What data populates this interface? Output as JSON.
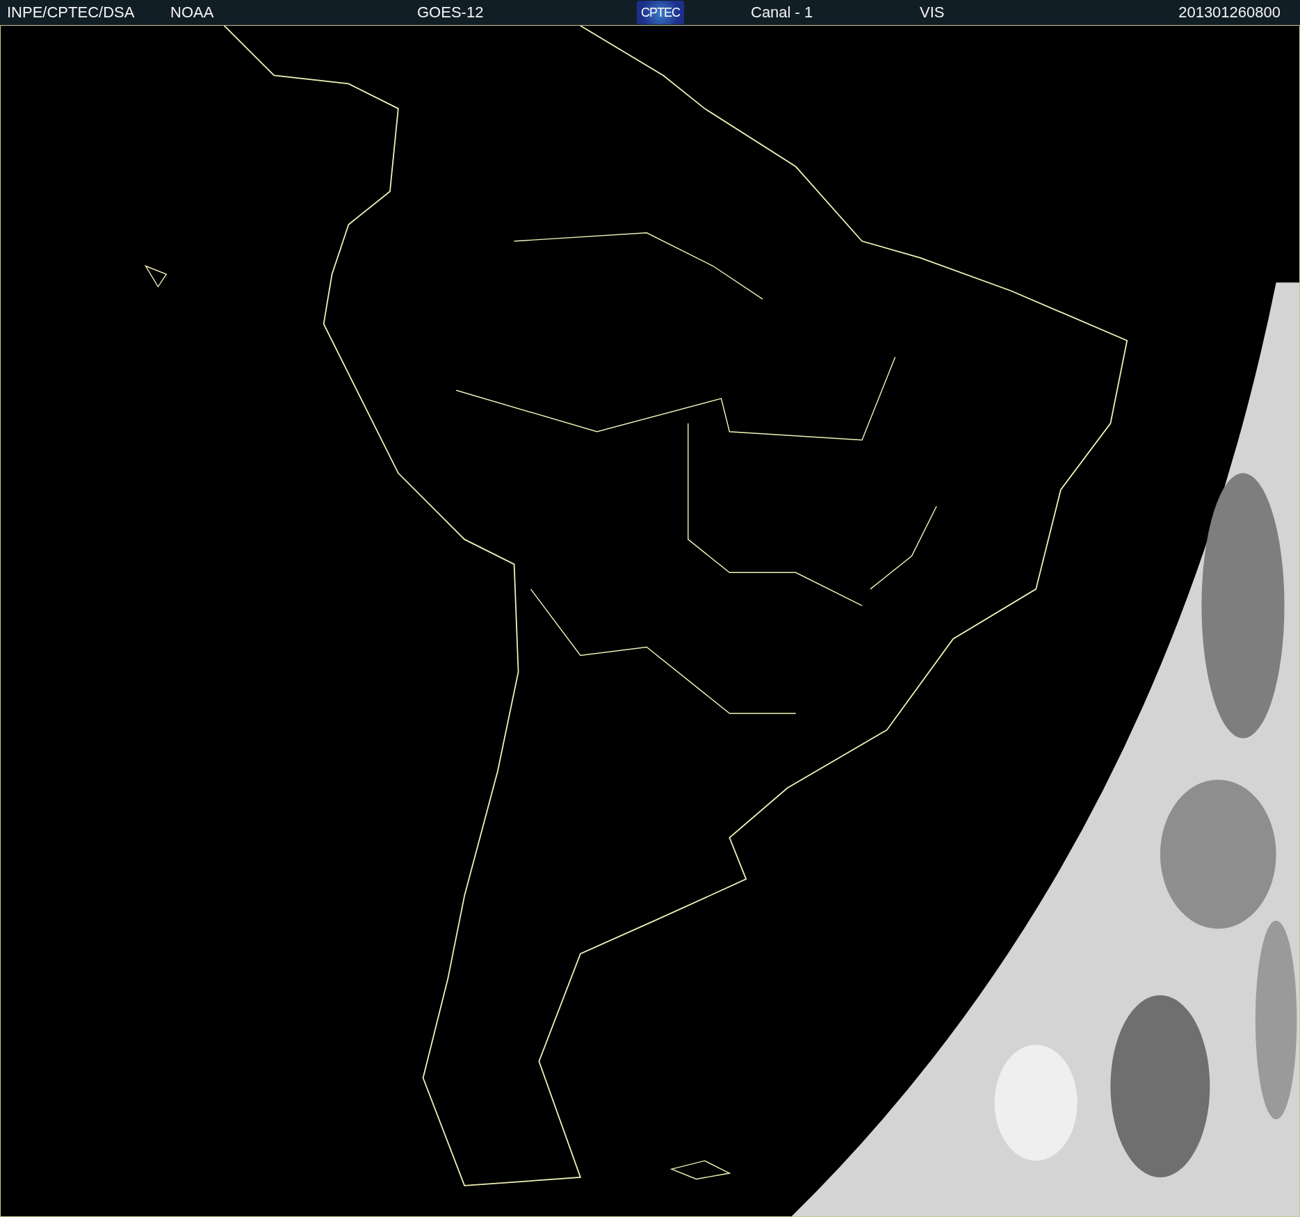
{
  "header": [
    {
      "kind": "text",
      "label": "INPE/CPTEC/DSA"
    },
    {
      "kind": "text",
      "label": "NOAA"
    },
    {
      "kind": "text",
      "label": "GOES-12"
    },
    {
      "kind": "logo",
      "label": "CPTEC"
    },
    {
      "kind": "text",
      "label": "Canal - 1"
    },
    {
      "kind": "text",
      "label": "VIS"
    },
    {
      "kind": "text",
      "label": "201301260800"
    }
  ]
}
